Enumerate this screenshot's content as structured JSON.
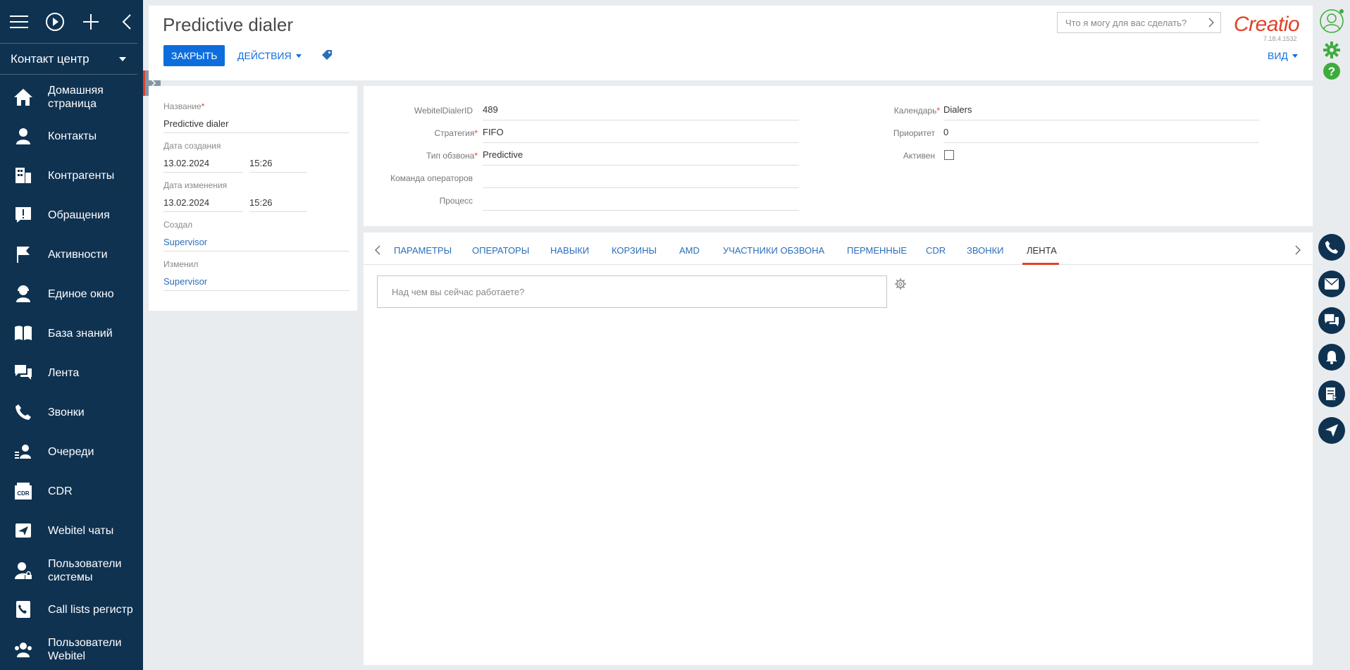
{
  "sidebar": {
    "workspace": "Контакт центр",
    "items": [
      {
        "label": "Домашняя страница",
        "icon": "home-icon"
      },
      {
        "label": "Контакты",
        "icon": "person-icon"
      },
      {
        "label": "Контрагенты",
        "icon": "building-icon"
      },
      {
        "label": "Обращения",
        "icon": "exclamation-icon"
      },
      {
        "label": "Активности",
        "icon": "flag-icon"
      },
      {
        "label": "Единое окно",
        "icon": "agent-icon"
      },
      {
        "label": "База знаний",
        "icon": "book-icon"
      },
      {
        "label": "Лента",
        "icon": "chat-icon"
      },
      {
        "label": "Звонки",
        "icon": "phone-icon"
      },
      {
        "label": "Очереди",
        "icon": "queue-icon"
      },
      {
        "label": "CDR",
        "icon": "cdr-icon"
      },
      {
        "label": "Webitel чаты",
        "icon": "send-icon"
      },
      {
        "label": "Пользователи системы",
        "icon": "user-lock-icon"
      },
      {
        "label": "Call lists регистр",
        "icon": "phone-list-icon"
      },
      {
        "label": "Пользователи Webitel",
        "icon": "users-icon"
      }
    ]
  },
  "header": {
    "title": "Predictive dialer",
    "close_label": "ЗАКРЫТЬ",
    "actions_label": "ДЕЙСТВИЯ",
    "search_placeholder": "Что я могу для вас сделать?",
    "logo": "Creatio",
    "version": "7.18.4.1532",
    "view_label": "ВИД"
  },
  "left_panel": {
    "name_label": "Название",
    "name_value": "Predictive dialer",
    "created_label": "Дата создания",
    "created_date": "13.02.2024",
    "created_time": "15:26",
    "modified_label": "Дата изменения",
    "modified_date": "13.02.2024",
    "modified_time": "15:26",
    "created_by_label": "Создал",
    "created_by": "Supervisor",
    "modified_by_label": "Изменил",
    "modified_by": "Supervisor"
  },
  "fields": {
    "dialer_id_label": "WebitelDialerID",
    "dialer_id": "489",
    "strategy_label": "Стратегия",
    "strategy": "FIFO",
    "type_label": "Тип обзвона",
    "type": "Predictive",
    "team_label": "Команда операторов",
    "team": "",
    "process_label": "Процесс",
    "process": "",
    "calendar_label": "Календарь",
    "calendar": "Dialers",
    "priority_label": "Приоритет",
    "priority": "0",
    "active_label": "Активен",
    "active": false
  },
  "tabs": [
    "ПАРАМЕТРЫ",
    "ОПЕРАТОРЫ",
    "НАВЫКИ",
    "КОРЗИНЫ",
    "AMD",
    "УЧАСТНИКИ ОБЗВОНА",
    "ПЕРМЕННЫЕ",
    "CDR",
    "ЗВОНКИ",
    "ЛЕНТА"
  ],
  "active_tab": "ЛЕНТА",
  "feed": {
    "placeholder": "Над чем вы сейчас работаете?"
  },
  "colors": {
    "sidebar_bg": "#0f3251",
    "primary": "#0e6ddd",
    "accent": "#e2412a",
    "link": "#2a6ebb"
  }
}
